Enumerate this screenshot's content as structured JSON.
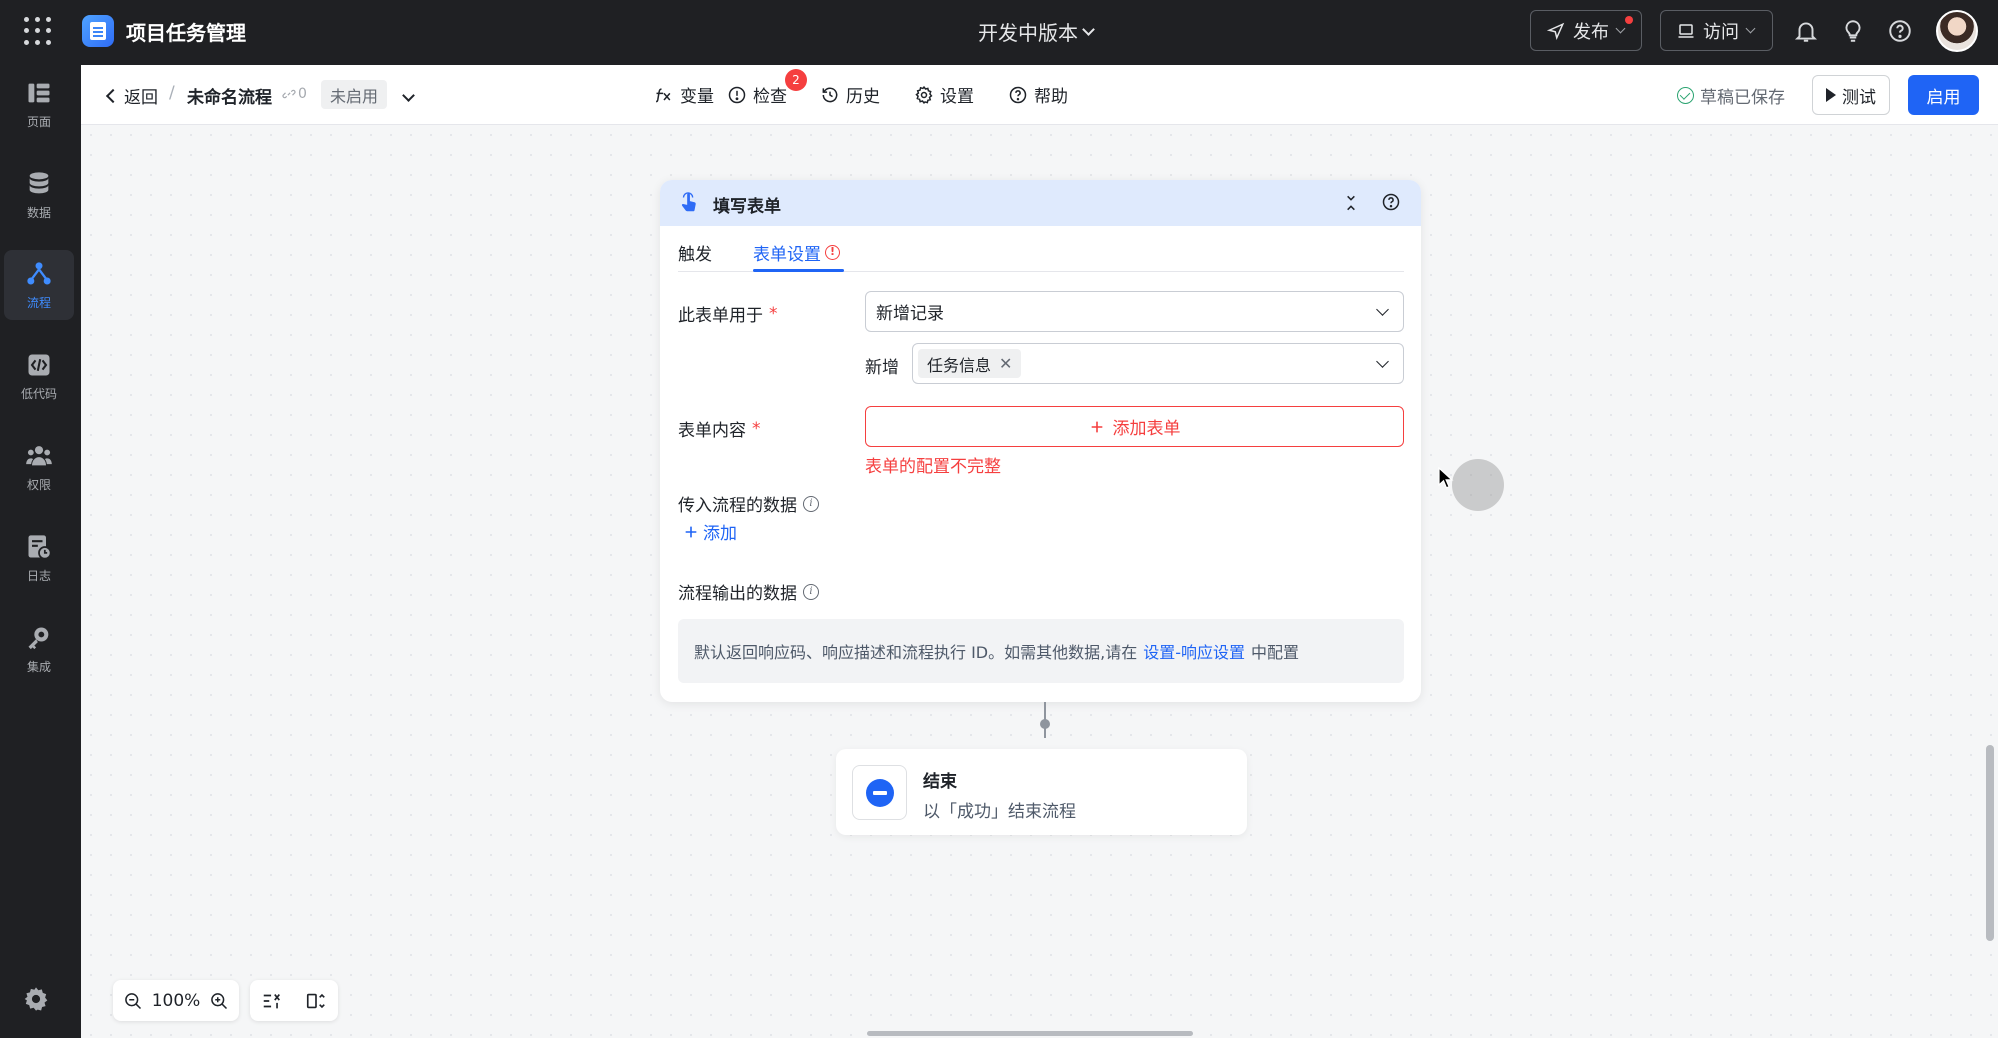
{
  "topbar": {
    "app_title": "项目任务管理",
    "version_label": "开发中版本",
    "publish_label": "发布",
    "visit_label": "访问",
    "icons": [
      "apps-grid-icon",
      "bell-icon",
      "lightbulb-icon",
      "help-icon"
    ]
  },
  "sidebar": {
    "items": [
      {
        "label": "页面",
        "icon": "page-icon"
      },
      {
        "label": "数据",
        "icon": "database-icon"
      },
      {
        "label": "流程",
        "icon": "flow-icon",
        "active": true
      },
      {
        "label": "低代码",
        "icon": "code-icon"
      },
      {
        "label": "权限",
        "icon": "users-icon"
      },
      {
        "label": "日志",
        "icon": "log-icon"
      },
      {
        "label": "集成",
        "icon": "key-icon"
      }
    ]
  },
  "subheader": {
    "back_label": "返回",
    "separator": "/",
    "flow_name": "未命名流程",
    "link_count": "0",
    "status": "未启用",
    "tools": [
      {
        "label": "变量",
        "icon": "variable-icon"
      },
      {
        "label": "检查",
        "icon": "alert-icon",
        "badge": "2"
      },
      {
        "label": "历史",
        "icon": "history-icon"
      },
      {
        "label": "设置",
        "icon": "gear-icon"
      },
      {
        "label": "帮助",
        "icon": "help-icon"
      }
    ],
    "saved_label": "草稿已保存",
    "test_label": "测试",
    "enable_label": "启用"
  },
  "form_node": {
    "title": "填写表单",
    "tabs": [
      "触发",
      "表单设置"
    ],
    "active_tab": 1,
    "used_for_label": "此表单用于",
    "used_for_value": "新增记录",
    "add_label": "新增",
    "add_tag": "任务信息",
    "content_label": "表单内容",
    "add_form_button": "添加表单",
    "error_text": "表单的配置不完整",
    "input_data_label": "传入流程的数据",
    "add_link": "添加",
    "output_data_label": "流程输出的数据",
    "note_text": "默认返回响应码、响应描述和流程执行 ID。如需其他数据,请在",
    "note_link": "设置-响应设置",
    "note_suffix": "中配置"
  },
  "end_node": {
    "title": "结束",
    "desc": "以「成功」结束流程"
  },
  "zoom": {
    "level": "100%"
  },
  "colors": {
    "accent": "#1f64f5",
    "error": "#f53f3f",
    "topbar_bg": "#1f2023",
    "canvas_bg": "#f5f6f7",
    "card_header_bg": "#dfeafd"
  }
}
